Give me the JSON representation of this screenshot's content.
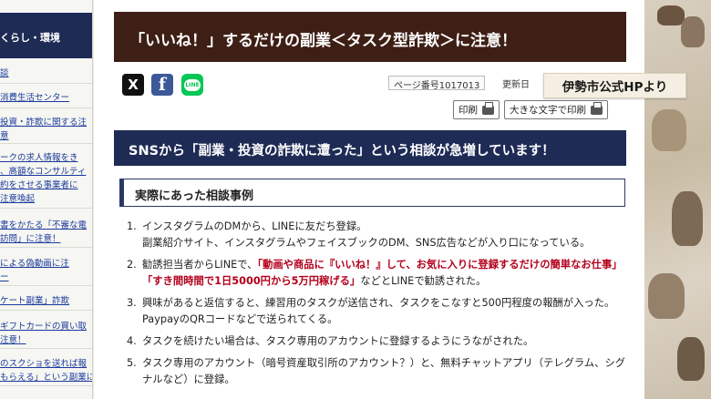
{
  "sidebar": {
    "header": "くらし・環境",
    "items": [
      {
        "label": "談"
      },
      {
        "label": "消費生活センター"
      },
      {
        "label": "投資・詐欺に関する注"
      },
      {
        "label": "意"
      },
      {
        "label": "ークの求人情報をき"
      },
      {
        "label": "、高額なコンサルティ"
      },
      {
        "label": "約をさせる事業者に"
      },
      {
        "label": "注意喚起"
      },
      {
        "label": "書をかたる「不審な電"
      },
      {
        "label": "訪問」に注意！"
      },
      {
        "label": "による偽動画に注"
      },
      {
        "label": "ー"
      },
      {
        "label": "ケート副業」詐欺"
      },
      {
        "label": "ギフトカードの買い取"
      },
      {
        "label": "注意！"
      },
      {
        "label": "のスクショを送れば報"
      },
      {
        "label": "もらえる」という副業に"
      }
    ]
  },
  "page": {
    "title": "「いいね！」するだけの副業＜タスク型詐欺＞に注意！",
    "page_number": "ページ番号1017013",
    "updated_label": "更新日",
    "print_label": "印刷",
    "large_print_label": "大きな文字で印刷",
    "section_heading": "SNSから「副業・投資の詐欺に遭った」という相談が急増しています！",
    "subheading": "実際にあった相談事例"
  },
  "share": {
    "x_icon": "X",
    "facebook_icon": "f",
    "line_icon": "LINE"
  },
  "cases": [
    {
      "num": "1.",
      "text": "インスタグラムのDMから、LINEに友だち登録。",
      "sub": "副業紹介サイト、インスタグラムやフェイスブックのDM、SNS広告などが入り口になっている。"
    },
    {
      "num": "2.",
      "pre": "勧誘担当者からLINEで、",
      "red": "「動画や商品に『いいね！』して、お気に入りに登録するだけの簡単なお仕事」「すき間時間で1日5000円から5万円稼げる」",
      "post": "などとLINEで勧誘された。"
    },
    {
      "num": "3.",
      "text": "興味があると返信すると、練習用のタスクが送信され、タスクをこなすと500円程度の報酬が入った。",
      "sub": "PaypayのQRコードなどで送られてくる。"
    },
    {
      "num": "4.",
      "text": "タスクを続けたい場合は、タスク専用のアカウントに登録するようにうながされた。"
    },
    {
      "num": "5.",
      "text": "タスク専用のアカウント（暗号資産取引所のアカウント？）と、無料チャットアプリ（テレグラム、シグナルなど）に登録。"
    }
  ],
  "overlay": {
    "caption": "伊勢市公式HPより"
  }
}
